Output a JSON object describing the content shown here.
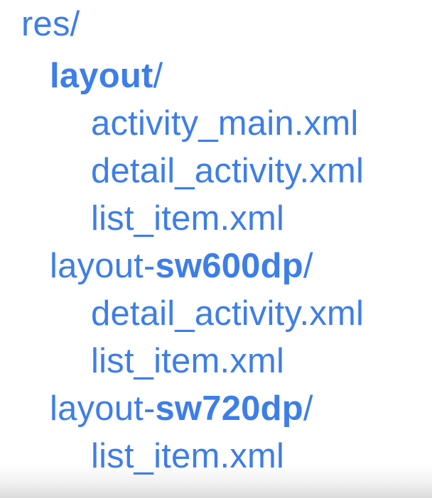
{
  "tree": {
    "root": {
      "name": "res",
      "sep": "/"
    },
    "folders": [
      {
        "prefix": "",
        "bold": "layout",
        "sep": "/",
        "files": [
          "activity_main.xml",
          "detail_activity.xml",
          "list_item.xml"
        ]
      },
      {
        "prefix": "layout-",
        "bold": "sw600dp",
        "sep": "/",
        "files": [
          "detail_activity.xml",
          "list_item.xml"
        ]
      },
      {
        "prefix": "layout-",
        "bold": "sw720dp",
        "sep": "/",
        "files": [
          "list_item.xml"
        ]
      }
    ]
  },
  "colors": {
    "text": "#3d7ee8",
    "background": "#ffffff"
  }
}
